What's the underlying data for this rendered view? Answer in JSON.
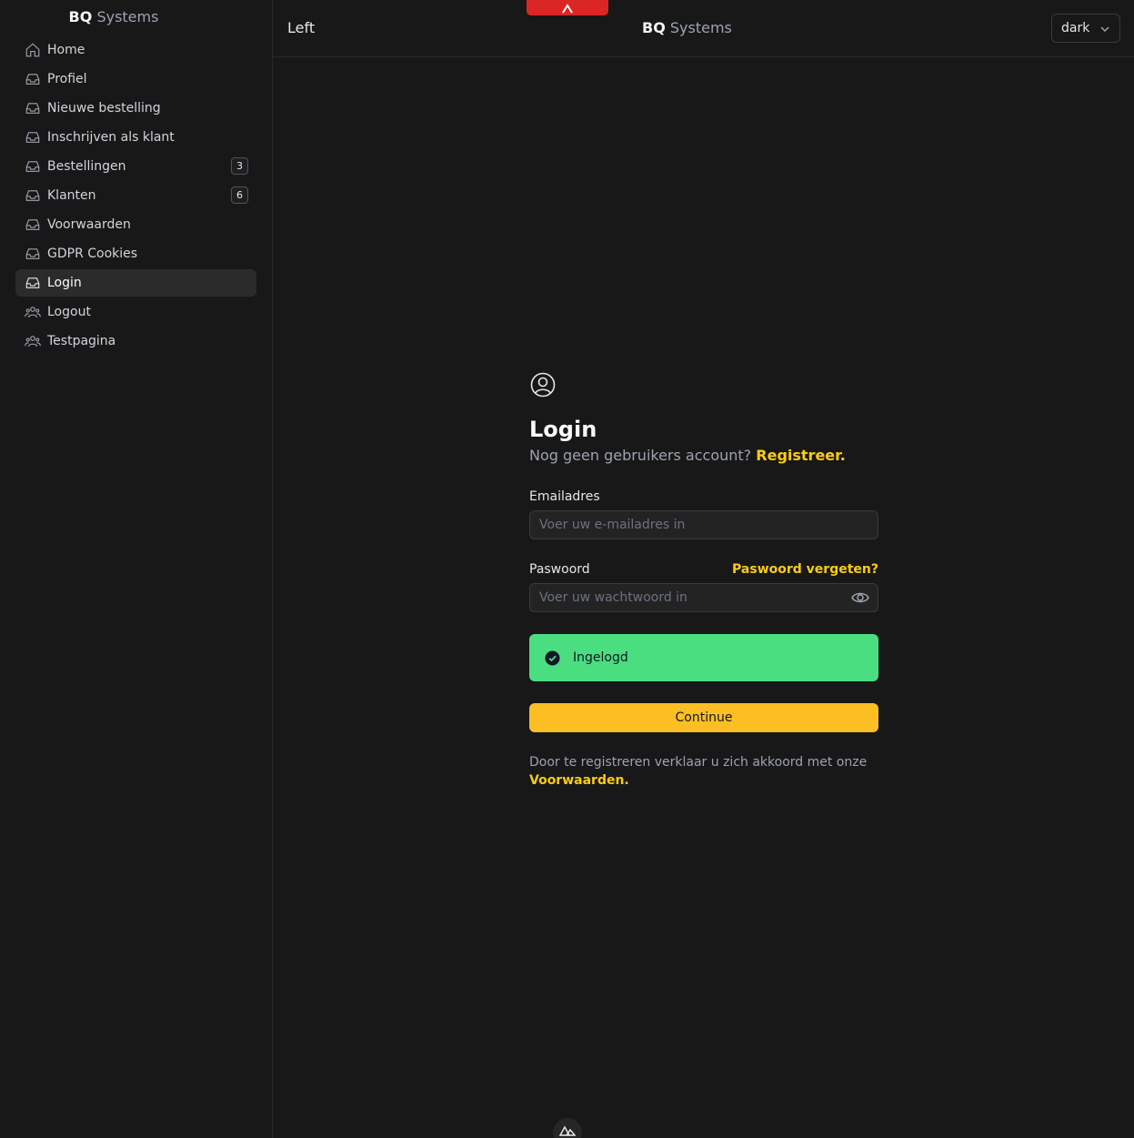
{
  "sidebar": {
    "brand_bold": "BQ",
    "brand_rest": "Systems",
    "items": [
      {
        "label": "Home",
        "icon": "home-icon"
      },
      {
        "label": "Profiel",
        "icon": "inbox-icon"
      },
      {
        "label": "Nieuwe bestelling",
        "icon": "inbox-icon"
      },
      {
        "label": "Inschrijven als klant",
        "icon": "inbox-icon"
      },
      {
        "label": "Bestellingen",
        "icon": "inbox-icon",
        "badge": "3"
      },
      {
        "label": "Klanten",
        "icon": "inbox-icon",
        "badge": "6"
      },
      {
        "label": "Voorwaarden",
        "icon": "inbox-icon"
      },
      {
        "label": "GDPR Cookies",
        "icon": "inbox-icon"
      },
      {
        "label": "Login",
        "icon": "inbox-icon",
        "active": true
      },
      {
        "label": "Logout",
        "icon": "users-icon"
      },
      {
        "label": "Testpagina",
        "icon": "users-icon"
      }
    ]
  },
  "header": {
    "left": "Left",
    "brand_bold": "BQ",
    "brand_rest": "Systems",
    "theme_value": "dark"
  },
  "login": {
    "title": "Login",
    "subtitle": "Nog geen gebruikers account?",
    "register_link": "Registreer.",
    "email_label": "Emailadres",
    "email_placeholder": "Voer uw e-mailadres in",
    "password_label": "Paswoord",
    "forgot_link": "Paswoord vergeten?",
    "password_placeholder": "Voer uw wachtwoord in",
    "alert_text": "Ingelogd",
    "continue_label": "Continue",
    "terms_text": "Door te registreren verklaar u zich akkoord met onze",
    "terms_link": "Voorwaarden."
  },
  "colors": {
    "background": "#181818",
    "accent": "#facc15",
    "success": "#4ade80",
    "button": "#fbbf24",
    "top_tab": "#dc2626"
  }
}
